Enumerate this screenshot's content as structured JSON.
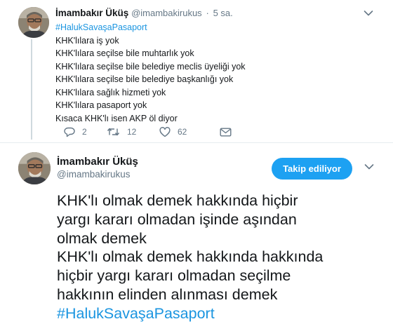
{
  "reply_tweet": {
    "author_name": "İmambakır Üküş",
    "author_handle": "@imambakirukus",
    "separator": "·",
    "time": "5 sa.",
    "lines": [
      "#HalukSavaşaPasaport",
      "KHK'lılara iş yok",
      "KHK'lılara seçilse bile muhtarlık yok",
      "KHK'lılara seçilse bile belediye meclis üyeliği yok",
      "KHK'lılara seçilse bile belediye başkanlığı yok",
      "KHK'lılara sağlık hizmeti yok",
      "KHK'lılara pasaport yok",
      "Kısaca KHK'lı isen AKP öl diyor"
    ],
    "actions": {
      "reply_count": "2",
      "retweet_count": "12",
      "like_count": "62"
    },
    "icons": [
      "avatar",
      "chevron-down-icon",
      "reply-icon",
      "retweet-icon",
      "like-icon",
      "direct-message-icon"
    ]
  },
  "main_tweet": {
    "author_name": "İmambakır Üküş",
    "author_handle": "@imambakirukus",
    "follow_button_label": "Takip ediliyor",
    "lines": [
      "KHK'lı olmak demek hakkında hiçbir",
      "yargı kararı olmadan işinde aşından",
      "olmak demek",
      "KHK'lı olmak demek hakkında hakkında",
      "hiçbir yargı kararı olmadan seçilme",
      "hakkının elinden alınması demek",
      "#HalukSavaşaPasaport"
    ]
  },
  "colors": {
    "accent": "#1da1f2",
    "link": "#1b95e0",
    "text": "#14171a",
    "secondary_text": "#657786",
    "divider": "#e6ecf0"
  }
}
